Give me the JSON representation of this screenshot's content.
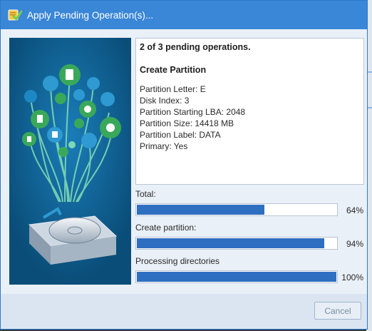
{
  "window": {
    "title": "Apply Pending Operation(s)..."
  },
  "info": {
    "progress_title": "2 of 3 pending operations.",
    "operation": "Create Partition",
    "details": [
      "Partition Letter: E",
      "Disk Index: 3",
      "Partition Starting LBA: 2048",
      "Partition Size: 14418 MB",
      "Partition Label: DATA",
      "Primary: Yes"
    ]
  },
  "progress": [
    {
      "label": "Total:",
      "percent_text": "64%",
      "fraction": 0.64
    },
    {
      "label": "Create partition:",
      "percent_text": "94%",
      "fraction": 0.94
    },
    {
      "label": "Processing directories",
      "percent_text": "100%",
      "fraction": 1.0
    }
  ],
  "footer": {
    "cancel_label": "Cancel"
  },
  "colors": {
    "title_bar": "#3a86d7",
    "progress_fill": "#2f6fc1",
    "illustration_bg": "#0a4d78"
  }
}
